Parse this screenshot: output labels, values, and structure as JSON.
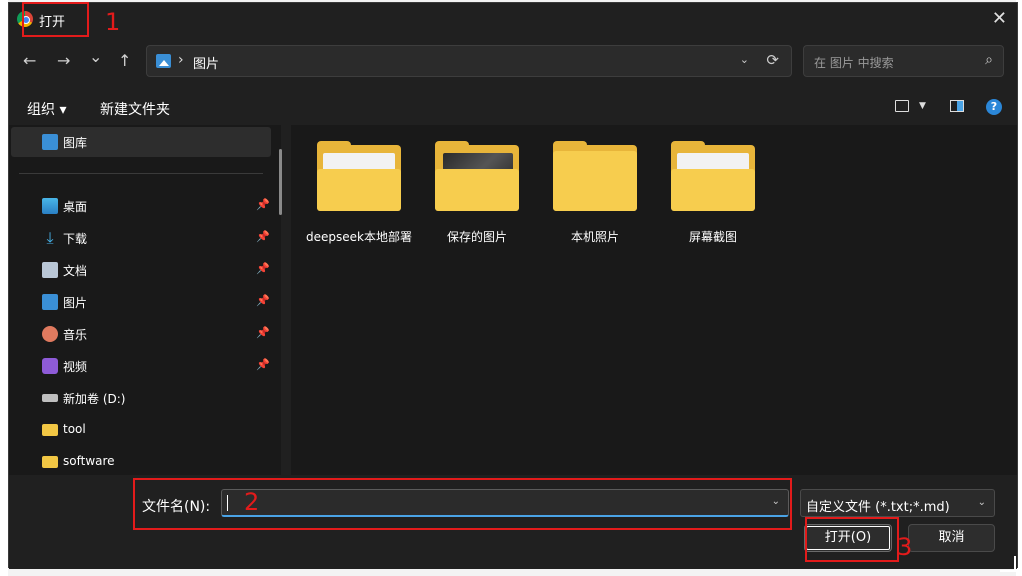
{
  "window": {
    "title": "打开"
  },
  "nav": {
    "back": "←",
    "forward": "→",
    "history": "⌄",
    "up": "↑",
    "address_sep": "›",
    "address": "图片",
    "address_dropdown": "⌄",
    "refresh": "⟳",
    "search_placeholder": "在 图片 中搜索",
    "search_icon": "⌕"
  },
  "toolbar": {
    "organize": "组织 ▾",
    "new_folder": "新建文件夹",
    "view_dropdown": "▼",
    "help": "?"
  },
  "sidebar": {
    "items": [
      {
        "label": "图库",
        "icon": "gallery-icon",
        "pinned": false
      },
      {
        "label": "桌面",
        "icon": "desktop-icon",
        "pinned": true
      },
      {
        "label": "下载",
        "icon": "download-icon",
        "pinned": true
      },
      {
        "label": "文档",
        "icon": "document-icon",
        "pinned": true
      },
      {
        "label": "图片",
        "icon": "pictures-icon",
        "pinned": true
      },
      {
        "label": "音乐",
        "icon": "music-icon",
        "pinned": true
      },
      {
        "label": "视频",
        "icon": "video-icon",
        "pinned": true
      },
      {
        "label": "新加卷 (D:)",
        "icon": "drive-icon",
        "pinned": false
      },
      {
        "label": "tool",
        "icon": "folder-icon",
        "pinned": false
      },
      {
        "label": "software",
        "icon": "folder-icon",
        "pinned": false
      }
    ],
    "pin_glyph": "📌",
    "download_glyph": "⤓"
  },
  "folders": [
    {
      "label": "deepseek本地部署",
      "preview": "document"
    },
    {
      "label": "保存的图片",
      "preview": "photo"
    },
    {
      "label": "本机照片",
      "preview": "empty"
    },
    {
      "label": "屏幕截图",
      "preview": "document"
    }
  ],
  "bottom": {
    "filename_label": "文件名(N):",
    "filename_value": "",
    "filename_dropdown": "⌄",
    "filetype": "自定义文件 (*.txt;*.md)",
    "filetype_dropdown": "⌄",
    "open_button": "打开(O)",
    "cancel_button": "取消"
  },
  "annotations": {
    "one": "1",
    "two": "2",
    "three": "3",
    "color": "#e21b1b"
  },
  "colors": {
    "background": "#202020",
    "panel": "#191919",
    "accent": "#4aa3e6",
    "folder": "#f7cd4e"
  },
  "window_controls": {
    "close": "✕"
  }
}
